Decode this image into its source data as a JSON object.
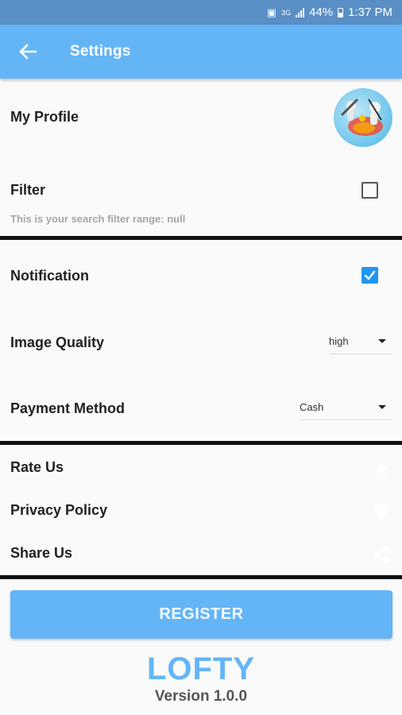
{
  "status_bar": {
    "battery": "44%",
    "time": "1:37 PM",
    "network": "3G"
  },
  "app_bar": {
    "title": "Settings",
    "back_icon": "arrow-left-icon"
  },
  "profile": {
    "label": "My Profile"
  },
  "filter": {
    "label": "Filter",
    "checked": false,
    "hint": "This is your search filter range: null"
  },
  "notification": {
    "label": "Notification",
    "checked": true
  },
  "image_quality": {
    "label": "Image Quality",
    "selected": "high"
  },
  "payment_method": {
    "label": "Payment Method",
    "selected": "Cash"
  },
  "links": [
    {
      "label": "Rate Us",
      "icon": "star-icon"
    },
    {
      "label": "Privacy Policy",
      "icon": "shield-icon"
    },
    {
      "label": "Share Us",
      "icon": "share-icon"
    }
  ],
  "register_button": "REGISTER",
  "brand": "LOFTY",
  "version": "Version 1.0.0",
  "colors": {
    "primary": "#64b5f6",
    "status_bar": "#5a8fc6",
    "checkbox_checked": "#2196f3"
  }
}
